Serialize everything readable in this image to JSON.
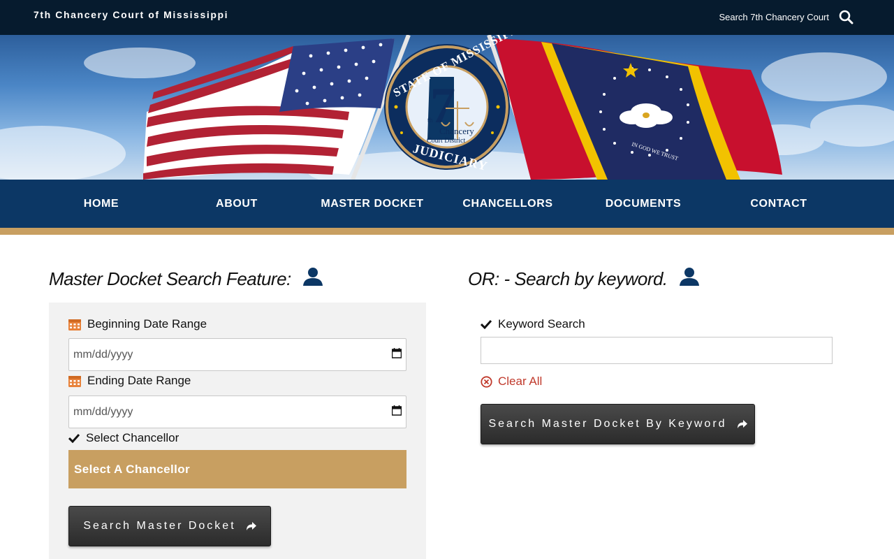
{
  "topbar": {
    "site_title": "7th Chancery Court of Mississippi",
    "search_label": "Search 7th Chancery Court",
    "search_icon": "search-icon"
  },
  "banner": {
    "seal_text_top": "STATE OF MISSISSIPPI",
    "seal_number": "7",
    "seal_suffix": "th",
    "seal_line1": "Chancery",
    "seal_line2": "Court District",
    "seal_text_bottom": "JUDICIARY",
    "flag_motto": "IN GOD WE TRUST"
  },
  "nav": {
    "items": [
      {
        "label": "HOME"
      },
      {
        "label": "ABOUT"
      },
      {
        "label": "MASTER DOCKET"
      },
      {
        "label": "CHANCELLORS"
      },
      {
        "label": "DOCUMENTS"
      },
      {
        "label": "CONTACT"
      }
    ]
  },
  "docket_search": {
    "heading": "Master Docket Search Feature:",
    "begin_label": "Beginning Date Range",
    "begin_placeholder": "mm/dd/yyyy",
    "end_label": "Ending Date Range",
    "end_placeholder": "mm/dd/yyyy",
    "chancellor_label": "Select Chancellor",
    "chancellor_select": "Select A Chancellor",
    "submit_label": "Search Master Docket"
  },
  "keyword_search": {
    "heading": "OR: - Search by keyword.",
    "label": "Keyword Search",
    "value": "",
    "clear_label": "Clear All",
    "submit_label": "Search Master Docket By Keyword"
  },
  "colors": {
    "topbar": "#061b2e",
    "nav": "#0c3765",
    "gold": "#c89f61",
    "calendar_icon": "#e8823a",
    "clear_red": "#c0392b"
  }
}
